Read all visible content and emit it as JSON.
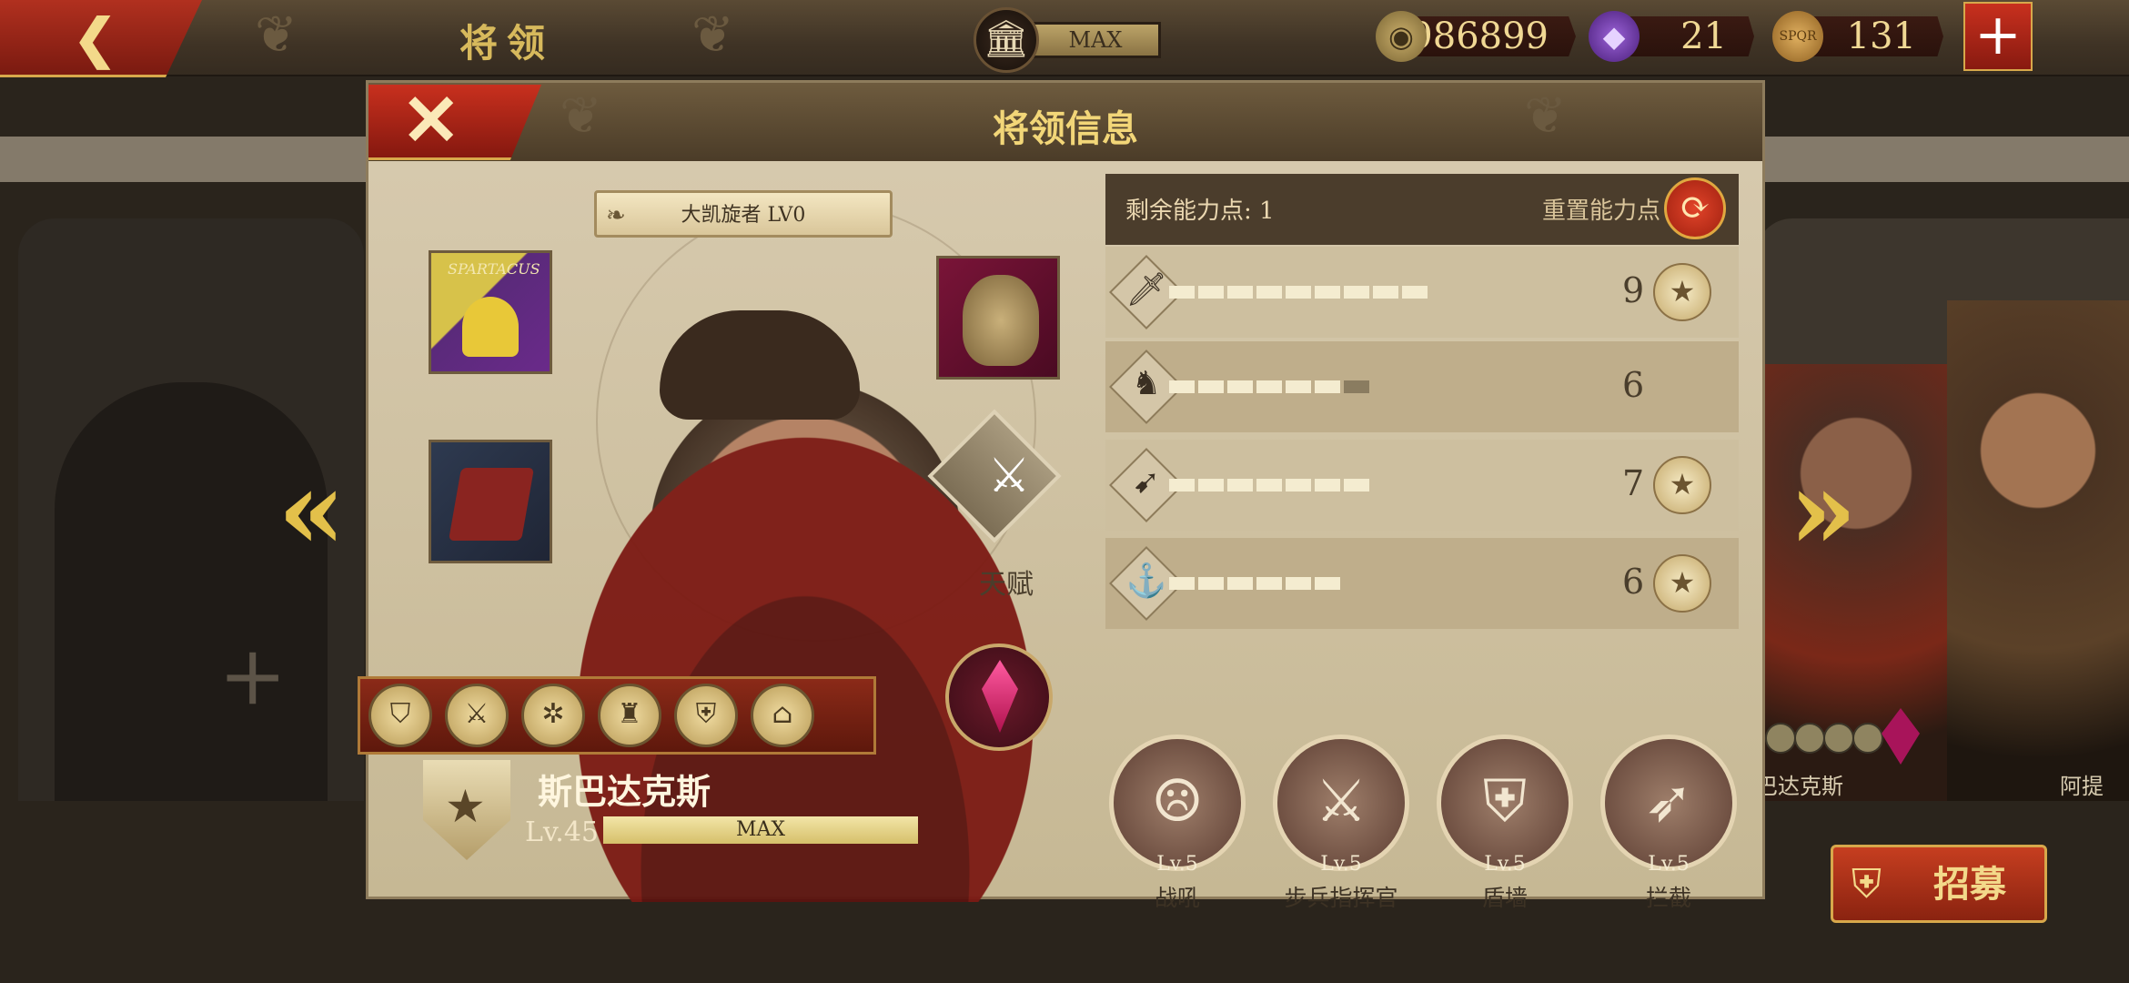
{
  "topbar": {
    "back_icon": "back-arrow-icon",
    "title": "将领",
    "bank_level": "MAX",
    "coins": "986899",
    "gems": "21",
    "tokens": "131",
    "token_icon_text": "SPQR",
    "add_icon": "plus-icon"
  },
  "background": {
    "left_slot_add": "+",
    "right_names": [
      "巴达克斯",
      "阿提"
    ],
    "recruit_label": "招募"
  },
  "modal": {
    "title": "将领信息",
    "close_icon": "close-icon",
    "triumph_badge": "大凯旋者 LV0",
    "talent_label": "天赋",
    "hero_name": "斯巴达克斯",
    "level_text": "Lv.45",
    "level_bar_text": "MAX",
    "equipment": [
      "spartacus-banner",
      "red-codex",
      "gladiator-helmet"
    ],
    "equip_flag_text": "SPARTACUS"
  },
  "stats": {
    "points_label": "剩余能力点: 1",
    "reset_label": "重置能力点",
    "rows": [
      {
        "icon": "sword-icon",
        "value": "9",
        "filled": 9,
        "total": 9,
        "rank_badge": true
      },
      {
        "icon": "horse-icon",
        "value": "6",
        "filled": 6,
        "total": 7,
        "rank_badge": false
      },
      {
        "icon": "bow-icon",
        "value": "7",
        "filled": 7,
        "total": 7,
        "rank_badge": true
      },
      {
        "icon": "anchor-icon",
        "value": "6",
        "filled": 6,
        "total": 6,
        "rank_badge": true
      }
    ]
  },
  "skills": [
    {
      "level": "Lv.5",
      "name": "战吼",
      "icon": "war-cry-icon"
    },
    {
      "level": "Lv.5",
      "name": "步兵指挥官",
      "icon": "crossed-swords-icon"
    },
    {
      "level": "Lv.5",
      "name": "盾墙",
      "icon": "shield-wall-icon"
    },
    {
      "level": "Lv.5",
      "name": "拦截",
      "icon": "intercept-icon"
    }
  ],
  "colors": {
    "accent_red": "#b1301f",
    "gold": "#d7b95c",
    "panel": "#d8cbb0"
  }
}
